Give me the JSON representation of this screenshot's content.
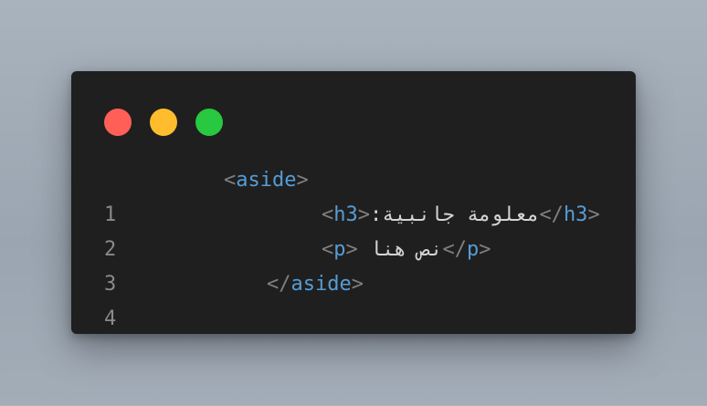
{
  "colors": {
    "close": "#ff5f57",
    "minimize": "#ffbd2e",
    "maximize": "#28c840",
    "tag": "#569cd6",
    "text": "#d4d4d4",
    "line_number": "#8a8a8a",
    "bracket": "#808080",
    "editor_bg": "#1f1f1f"
  },
  "window_controls": [
    "close",
    "minimize",
    "maximize"
  ],
  "code": {
    "lines": [
      {
        "number": "1",
        "open": "<",
        "tag": "aside",
        "close": ">"
      },
      {
        "number": "2",
        "open": "<",
        "tag": "h3",
        "close": ">",
        "text": "معلومة جانبية:",
        "end_open": "</",
        "end_tag": "h3",
        "end_close": ">"
      },
      {
        "number": "3",
        "open": "<",
        "tag": "p",
        "close": ">",
        "text": "نص هنا",
        "end_open": "</",
        "end_tag": "p",
        "end_close": ">"
      },
      {
        "number": "4",
        "open": "</",
        "tag": "aside",
        "close": ">"
      }
    ]
  }
}
